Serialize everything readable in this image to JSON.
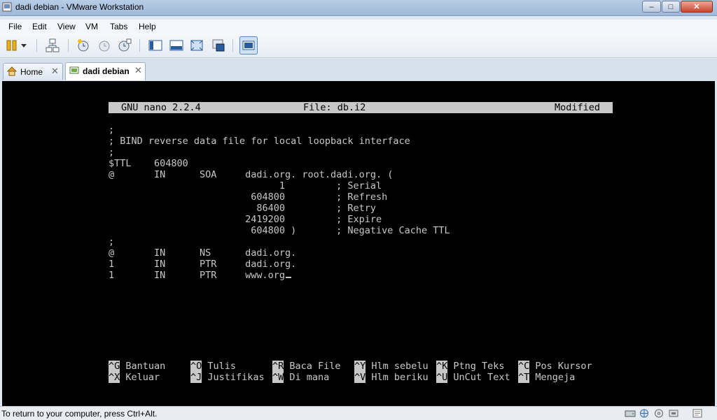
{
  "window": {
    "title": "dadi debian - VMware Workstation",
    "controls": {
      "minimize": "–",
      "maximize": "□",
      "close": "✕"
    }
  },
  "menu": [
    "File",
    "Edit",
    "View",
    "VM",
    "Tabs",
    "Help"
  ],
  "toolbar": {
    "icons": [
      "power-pause-icon",
      "dropdown-arrow-icon",
      "network-icon",
      "snapshot-take-icon",
      "snapshot-revert-icon",
      "snapshot-manager-icon",
      "normal-view-icon",
      "quick-switch-icon",
      "full-screen-icon",
      "unity-icon",
      "console-view-icon"
    ]
  },
  "tabs": [
    {
      "label": "Home",
      "close": "✕",
      "active": false
    },
    {
      "label": "dadi debian",
      "close": "✕",
      "active": true
    }
  ],
  "nano": {
    "header": {
      "app": "GNU nano 2.2.4",
      "file": "File: db.i2",
      "status": "Modified"
    },
    "lines": [
      ";",
      "; BIND reverse data file for local loopback interface",
      ";",
      "$TTL    604800",
      "@       IN      SOA     dadi.org. root.dadi.org. (",
      "                              1         ; Serial",
      "                         604800         ; Refresh",
      "                          86400         ; Retry",
      "                        2419200         ; Expire",
      "                         604800 )       ; Negative Cache TTL",
      ";",
      "@       IN      NS      dadi.org.",
      "1       IN      PTR     dadi.org.",
      "1       IN      PTR     www.org"
    ],
    "shortcuts_row1": [
      {
        "key": "^G",
        "label": " Bantuan"
      },
      {
        "key": "^O",
        "label": " Tulis"
      },
      {
        "key": "^R",
        "label": " Baca File"
      },
      {
        "key": "^Y",
        "label": " Hlm sebelu"
      },
      {
        "key": "^K",
        "label": " Ptng Teks"
      },
      {
        "key": "^C",
        "label": " Pos Kursor"
      }
    ],
    "shortcuts_row2": [
      {
        "key": "^X",
        "label": " Keluar"
      },
      {
        "key": "^J",
        "label": " Justifikas"
      },
      {
        "key": "^W",
        "label": " Di mana"
      },
      {
        "key": "^V",
        "label": " Hlm beriku"
      },
      {
        "key": "^U",
        "label": " UnCut Text"
      },
      {
        "key": "^T",
        "label": " Mengeja"
      }
    ]
  },
  "statusbar": {
    "text": "To return to your computer, press Ctrl+Alt.",
    "icons": [
      "hard-disk-icon",
      "network-adapter-icon",
      "cd-drive-icon",
      "usb-icon",
      "messages-icon"
    ]
  }
}
